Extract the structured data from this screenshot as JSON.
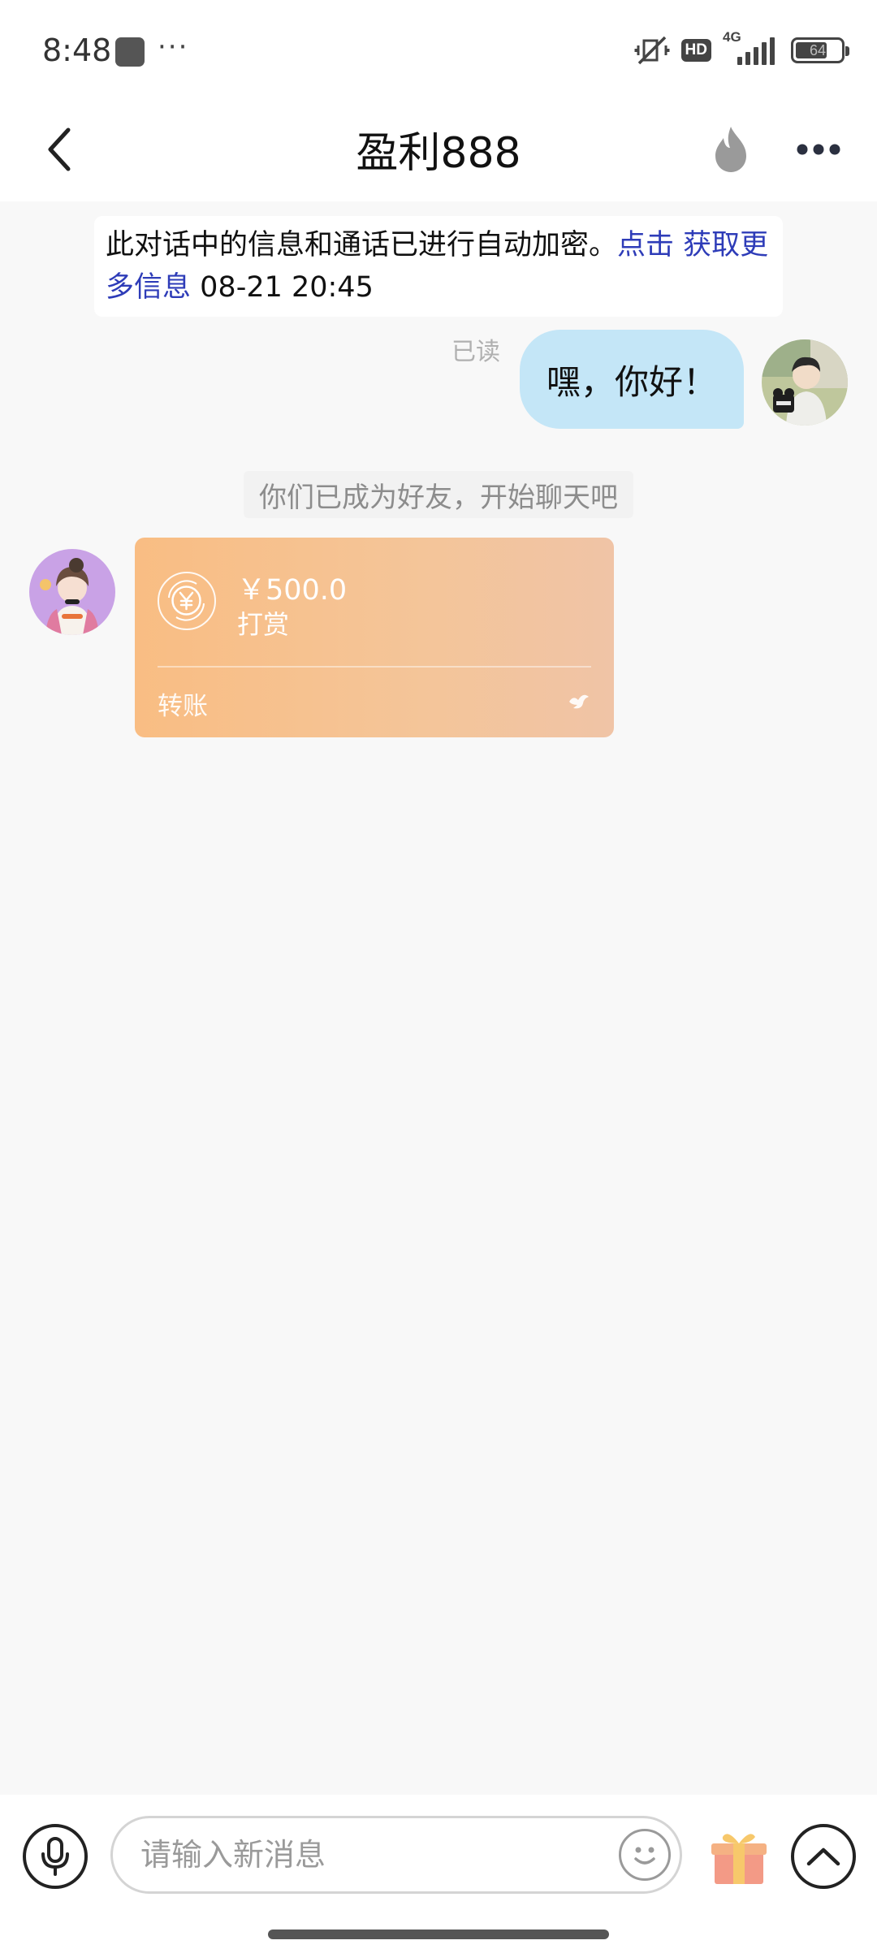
{
  "status_bar": {
    "time": "8:48",
    "network": "4G",
    "hd_label": "HD",
    "battery": "64"
  },
  "header": {
    "title": "盈利888"
  },
  "notice": {
    "text": "此对话中的信息和通话已进行自动加密。",
    "link": "点击 获取更多信息",
    "timestamp": "08-21 20:45"
  },
  "messages": {
    "outgoing_text": "嘿，你好！",
    "read_status": "已读",
    "system_text": "你们已成为好友，开始聊天吧"
  },
  "transfer": {
    "amount": "￥500.0",
    "description": "打赏",
    "type": "转账"
  },
  "input": {
    "placeholder": "请输入新消息"
  },
  "colors": {
    "bubble_outgoing": "#c4e6f7",
    "link": "#2e3cb8",
    "transfer_card": "#f9bd83"
  }
}
